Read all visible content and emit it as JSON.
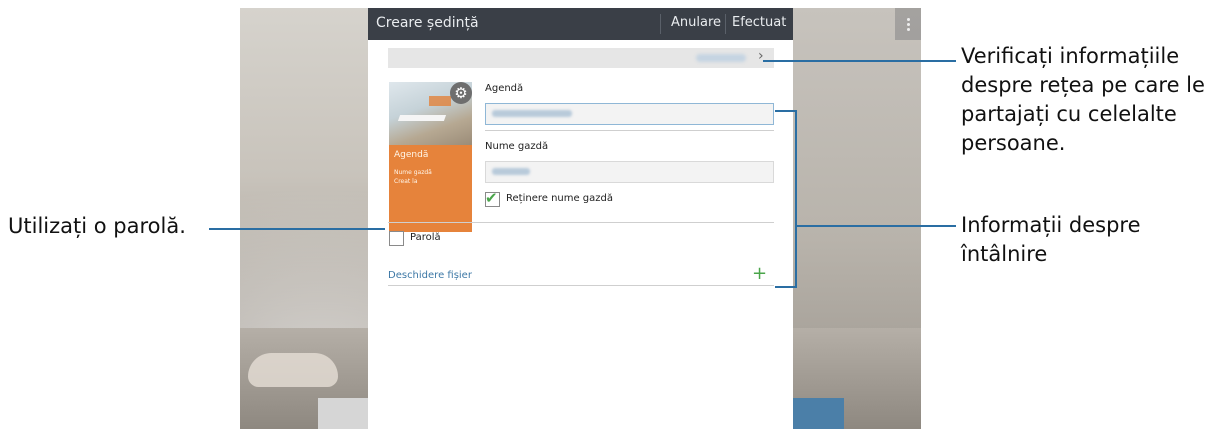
{
  "action_bar": {
    "title": "Creare ședință",
    "cancel_label": "Anulare",
    "done_label": "Efectuat"
  },
  "thumbnail": {
    "label": "Agendă",
    "host_label": "Nume gazdă",
    "created_label": "Creat la"
  },
  "form": {
    "agenda_label": "Agendă",
    "host_label": "Nume gazdă",
    "remember_label": "Reținere nume gazdă",
    "password_label": "Parolă",
    "open_file_label": "Deschidere fișier"
  },
  "callouts": {
    "network": "Verificați informațiile despre rețea pe care le partajați cu celelalte persoane.",
    "meeting": "Informații despre întâlnire",
    "password": "Utilizați o parolă."
  },
  "colors": {
    "accent": "#2a6ea3",
    "action_bar": "#3a3f47",
    "thumbnail": "#e6833b",
    "check": "#4aa54a"
  }
}
